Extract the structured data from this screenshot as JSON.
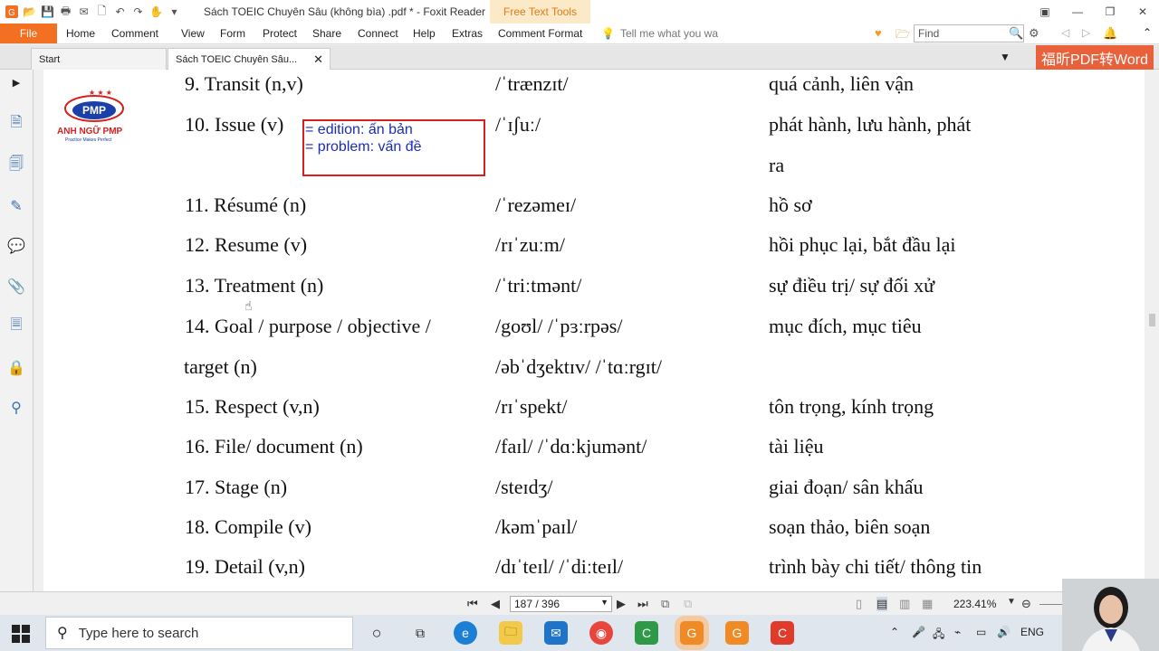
{
  "window": {
    "title": "Sách TOEIC Chuyên Sâu (không bìa) .pdf * - Foxit Reader",
    "context_tab": "Free Text Tools"
  },
  "ribbon": {
    "file": "File",
    "menus": [
      "Home",
      "Comment",
      "View",
      "Form",
      "Protect",
      "Share",
      "Connect",
      "Help",
      "Extras",
      "Comment Format"
    ],
    "tell_me": "Tell me what you wa",
    "find_placeholder": "Find"
  },
  "tabs": {
    "start": "Start",
    "document": "Sách TOEIC Chuyên Sâu...",
    "brand": "福昕PDF转Word"
  },
  "logo": {
    "name": "ANH NGỮ PMP",
    "tagline": "Practice Makes Perfect",
    "mark": "PMP"
  },
  "note": {
    "line1": "= edition: ấn bản",
    "line2": "= problem: vấn đề"
  },
  "vocab": [
    {
      "word": "9. Transit (n,v)",
      "ipa": "/ˈtrænzɪt/",
      "meaning": "quá cảnh, liên vận"
    },
    {
      "word": "10. Issue (v)",
      "ipa": "/ˈɪʃuː/",
      "meaning": "phát hành, lưu hành, phát",
      "meaning2": "ra"
    },
    {
      "word": "11. Résumé (n)",
      "ipa": "/ˈrezəmeɪ/",
      "meaning": "hồ sơ"
    },
    {
      "word": "12. Resume (v)",
      "ipa": "/rɪˈzuːm/",
      "meaning": "hồi phục lại, bắt đầu lại"
    },
    {
      "word": "13. Treatment (n)",
      "ipa": "/ˈtriːtmənt/",
      "meaning": "sự điều trị/ sự đối xử"
    },
    {
      "word": "14. Goal / purpose / objective /",
      "word2": "target (n)",
      "ipa": "/goʊl/ /ˈpɜːrpəs/",
      "ipa2": "/əbˈdʒektɪv/ /ˈtɑːrgɪt/",
      "meaning": "mục đích, mục tiêu"
    },
    {
      "word": "15. Respect (v,n)",
      "ipa": "/rɪˈspekt/",
      "meaning": "tôn trọng, kính trọng"
    },
    {
      "word": "16. File/ document (n)",
      "ipa": "/faɪl/ /ˈdɑːkjumənt/",
      "meaning": "tài liệu"
    },
    {
      "word": "17. Stage (n)",
      "ipa": "/steɪdʒ/",
      "meaning": "giai đoạn/ sân khấu"
    },
    {
      "word": "18. Compile (v)",
      "ipa": "/kəmˈpaɪl/",
      "meaning": "soạn thảo, biên soạn"
    },
    {
      "word": "19. Detail (v,n)",
      "ipa": "/dɪˈteɪl/ /ˈdiːteɪl/",
      "meaning": "trình bày chi tiết/ thông tin"
    }
  ],
  "statusbar": {
    "page": "187 / 396",
    "zoom": "223.41%"
  },
  "taskbar": {
    "search_placeholder": "Type here to search",
    "lang": "ENG"
  }
}
